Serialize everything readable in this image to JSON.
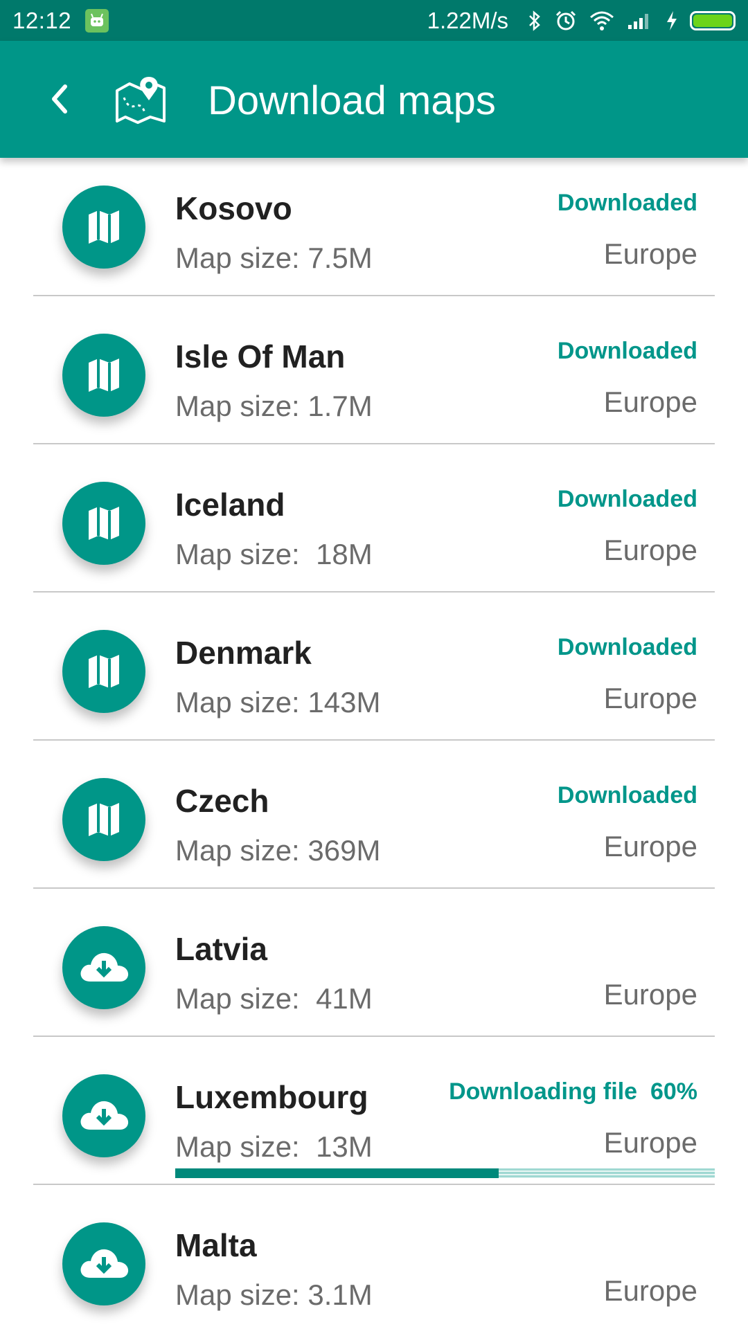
{
  "status_bar": {
    "time": "12:12",
    "net_speed": "1.22M/s",
    "icons": [
      "app-notification-icon",
      "bluetooth-icon",
      "alarm-icon",
      "wifi-icon",
      "signal-icon",
      "charging-icon",
      "battery-icon"
    ]
  },
  "app_bar": {
    "title": "Download maps",
    "back_icon": "chevron-left-icon",
    "logo_icon": "map-pin-icon"
  },
  "colors": {
    "primary": "#009688",
    "primary_dark": "#00796b",
    "accent_text": "#00968a",
    "progress": "#00897b"
  },
  "maps": [
    {
      "name": "Kosovo",
      "size": "Map size: 7.5M",
      "status": "Downloaded",
      "region": "Europe",
      "icon": "map-icon"
    },
    {
      "name": "Isle Of Man",
      "size": "Map size: 1.7M",
      "status": "Downloaded",
      "region": "Europe",
      "icon": "map-icon"
    },
    {
      "name": "Iceland",
      "size": "Map size:  18M",
      "status": "Downloaded",
      "region": "Europe",
      "icon": "map-icon"
    },
    {
      "name": "Denmark",
      "size": "Map size: 143M",
      "status": "Downloaded",
      "region": "Europe",
      "icon": "map-icon"
    },
    {
      "name": "Czech",
      "size": "Map size: 369M",
      "status": "Downloaded",
      "region": "Europe",
      "icon": "map-icon"
    },
    {
      "name": "Latvia",
      "size": "Map size:  41M",
      "status": "",
      "region": "Europe",
      "icon": "cloud-download-icon"
    },
    {
      "name": "Luxembourg",
      "size": "Map size:  13M",
      "status": "Downloading file  60%",
      "region": "Europe",
      "icon": "cloud-download-icon",
      "progress": 0.6
    },
    {
      "name": "Malta",
      "size": "Map size: 3.1M",
      "status": "",
      "region": "Europe",
      "icon": "cloud-download-icon"
    }
  ]
}
